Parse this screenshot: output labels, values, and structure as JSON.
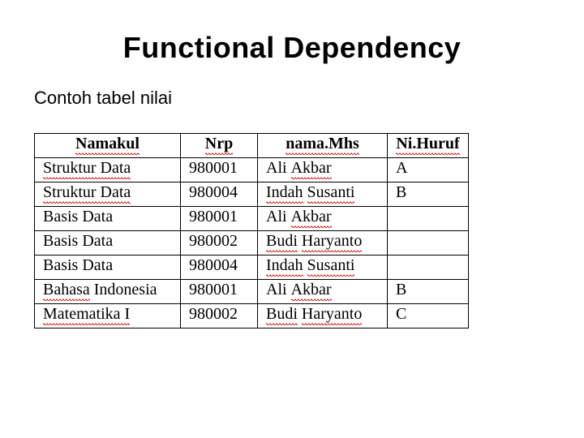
{
  "title": "Functional Dependency",
  "subtitle": "Contoh tabel nilai",
  "table": {
    "headers": [
      "Namakul",
      "Nrp",
      "nama.Mhs",
      "Ni.Huruf"
    ],
    "rows": [
      {
        "namakul": "Struktur Data",
        "nrp": "980001",
        "namamhs": "Ali Akbar",
        "nihuruf": "A"
      },
      {
        "namakul": "Struktur Data",
        "nrp": "980004",
        "namamhs": "Indah Susanti",
        "nihuruf": "B"
      },
      {
        "namakul": "Basis Data",
        "nrp": "980001",
        "namamhs": "Ali Akbar",
        "nihuruf": ""
      },
      {
        "namakul": "Basis Data",
        "nrp": "980002",
        "namamhs": "Budi Haryanto",
        "nihuruf": ""
      },
      {
        "namakul": "Basis Data",
        "nrp": "980004",
        "namamhs": "Indah Susanti",
        "nihuruf": ""
      },
      {
        "namakul": "Bahasa Indonesia",
        "nrp": "980001",
        "namamhs": "Ali Akbar",
        "nihuruf": "B"
      },
      {
        "namakul": "Matematika I",
        "nrp": "980002",
        "namamhs": "Budi Haryanto",
        "nihuruf": "C"
      }
    ]
  }
}
